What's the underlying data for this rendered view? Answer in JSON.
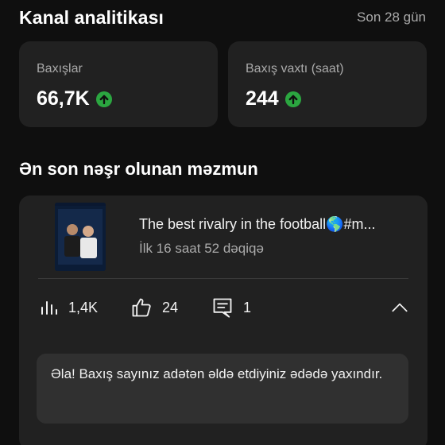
{
  "header": {
    "title": "Kanal analitikası",
    "period": "Son 28 gün"
  },
  "stats": [
    {
      "label": "Baxışlar",
      "value": "66,7K",
      "trend": "up"
    },
    {
      "label": "Baxış vaxtı (saat)",
      "value": "244",
      "trend": "up"
    }
  ],
  "latest": {
    "section_title": "Ən son nəşr olunan məzmun",
    "video_title": "The best rivalry in the football🌎#m...",
    "video_meta": "İlk 16 saat 52 dəqiqə",
    "views": "1,4K",
    "likes": "24",
    "comments": "1",
    "insight": "Əla! Baxış sayınız adətən əldə etdiyiniz ədədə yaxındır."
  },
  "colors": {
    "background": "#0f0f0f",
    "card": "#212121",
    "trend_up": "#2ba640"
  }
}
